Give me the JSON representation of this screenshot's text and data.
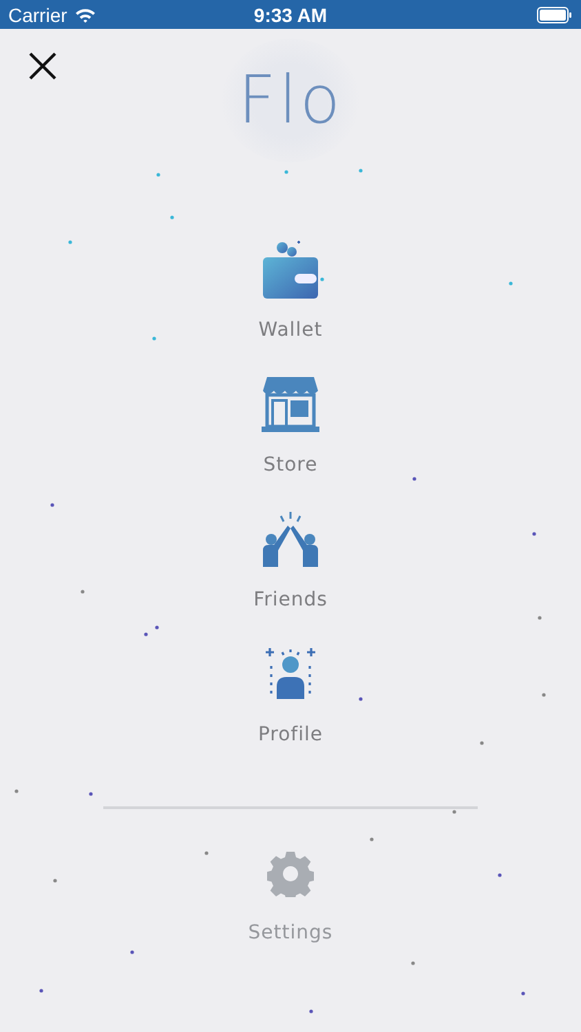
{
  "status_bar": {
    "carrier": "Carrier",
    "time": "9:33 AM"
  },
  "logo": {
    "text": "Flo"
  },
  "menu": [
    {
      "label": "Wallet",
      "kind": "wallet",
      "disabled": false
    },
    {
      "label": "Store",
      "kind": "store",
      "disabled": false
    },
    {
      "label": "Friends",
      "kind": "friends",
      "disabled": false
    },
    {
      "label": "Profile",
      "kind": "profile",
      "disabled": false
    }
  ],
  "settings": {
    "label": "Settings",
    "disabled": true
  }
}
